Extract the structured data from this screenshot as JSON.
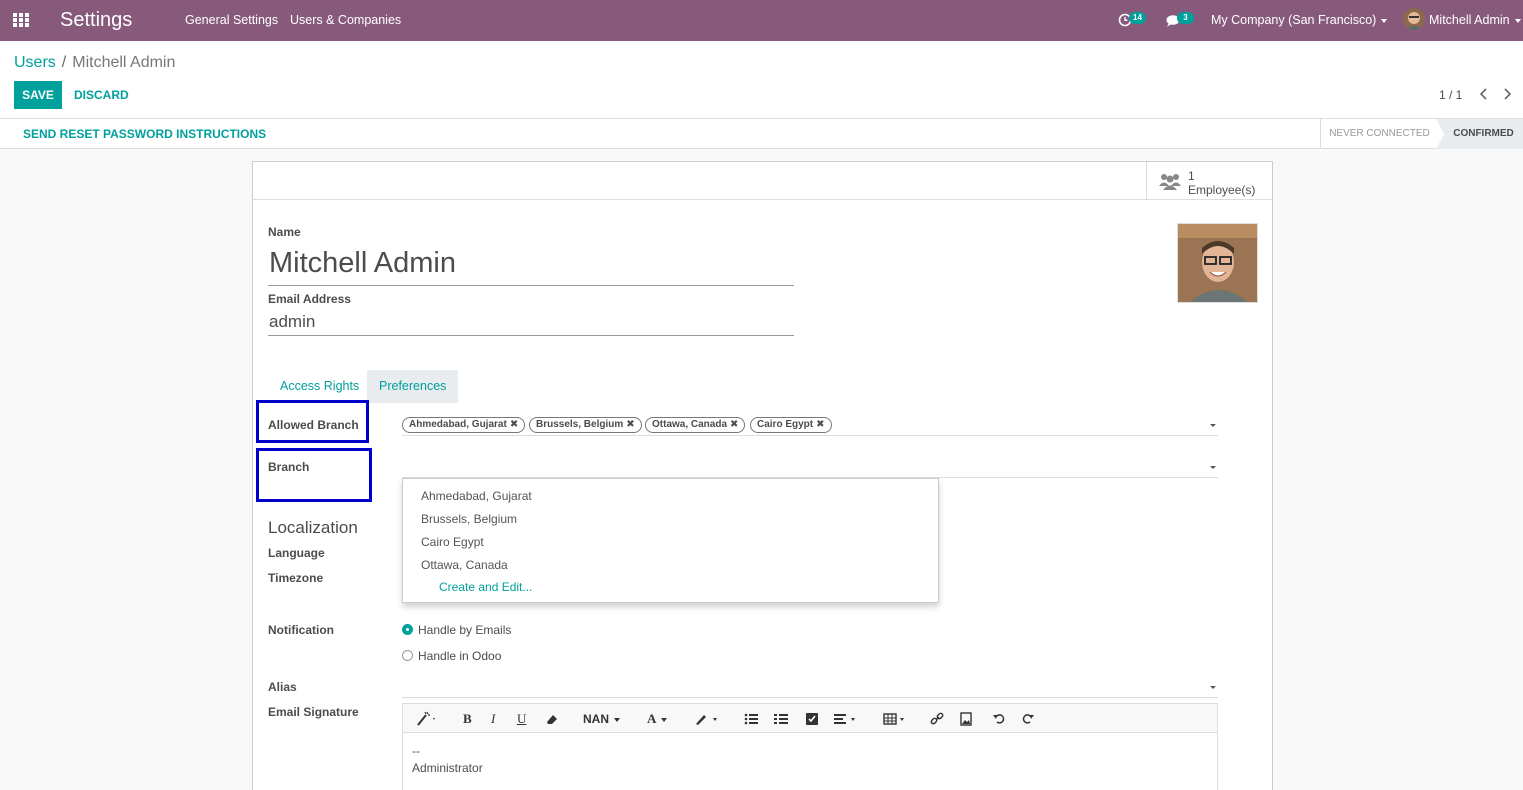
{
  "navbar": {
    "app_title": "Settings",
    "menu": [
      "General Settings",
      "Users & Companies"
    ],
    "activity_badge": "14",
    "messages_badge": "3",
    "company": "My Company (San Francisco)",
    "user": "Mitchell Admin"
  },
  "control_panel": {
    "breadcrumb_parent": "Users",
    "breadcrumb_separator": "/",
    "breadcrumb_current": "Mitchell Admin",
    "save_label": "SAVE",
    "discard_label": "DISCARD",
    "pager": "1 / 1"
  },
  "statusbar": {
    "reset_password_label": "SEND RESET PASSWORD INSTRUCTIONS",
    "stages": [
      "NEVER CONNECTED",
      "CONFIRMED"
    ],
    "active_stage": "CONFIRMED"
  },
  "smart_button": {
    "count": "1",
    "label": "Employee(s)"
  },
  "form": {
    "name_label": "Name",
    "name_value": "Mitchell Admin",
    "email_label": "Email Address",
    "email_value": "admin",
    "tabs": [
      "Access Rights",
      "Preferences"
    ],
    "active_tab": "Preferences",
    "allowed_branch_label": "Allowed Branch",
    "allowed_branches": [
      "Ahmedabad, Gujarat",
      "Brussels, Belgium",
      "Ottawa, Canada",
      "Cairo Egypt"
    ],
    "branch_label": "Branch",
    "branch_dropdown": [
      "Ahmedabad, Gujarat",
      "Brussels, Belgium",
      "Cairo Egypt",
      "Ottawa, Canada"
    ],
    "create_and_edit": "Create and Edit...",
    "localization_title": "Localization",
    "language_label": "Language",
    "timezone_label": "Timezone",
    "notification_label": "Notification",
    "notification_options": [
      "Handle by Emails",
      "Handle in Odoo"
    ],
    "notification_selected": "Handle by Emails",
    "alias_label": "Alias",
    "signature_label": "Email Signature",
    "font_size_label": "NAN",
    "signature_lines": [
      "--",
      "Administrator"
    ]
  },
  "colors": {
    "navbar": "#875a7b",
    "accent": "#00a09d",
    "highlight": "#0000cc"
  }
}
